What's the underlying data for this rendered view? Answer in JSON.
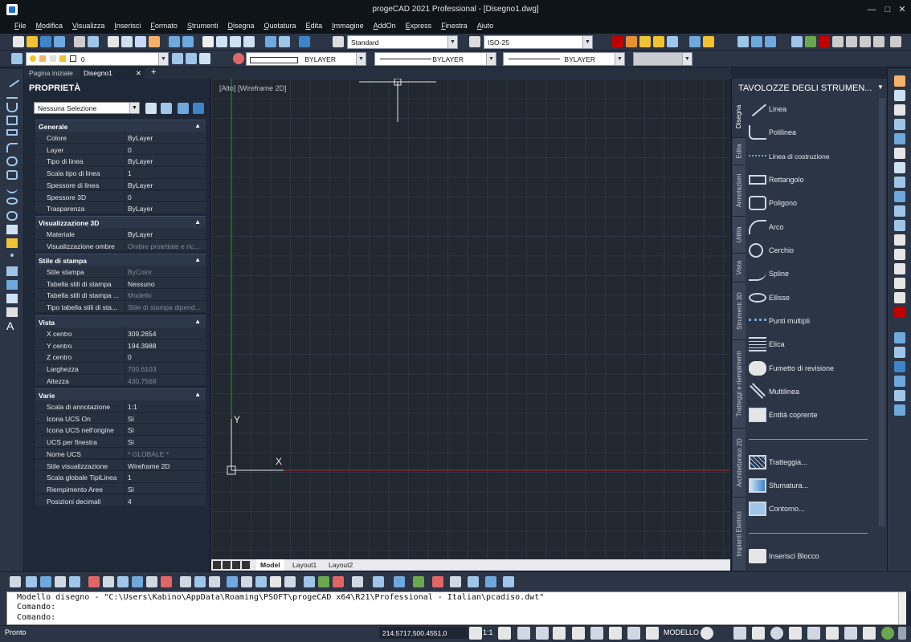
{
  "window": {
    "title": "progeCAD 2021 Professional - [Disegno1.dwg]",
    "minimize": "—",
    "restore": "□",
    "close": "✕"
  },
  "menu": [
    "File",
    "Modifica",
    "Visualizza",
    "Inserisci",
    "Formato",
    "Strumenti",
    "Disegna",
    "Quotatura",
    "Edita",
    "Immagine",
    "AddOn",
    "Express",
    "Finestra",
    "Aiuto"
  ],
  "toolbar": {
    "text_style": "Standard",
    "dim_style": "ISO-25",
    "layer": "0",
    "color": "BYLAYER",
    "linetype": "BYLAYER",
    "lineweight": "BYLAYER",
    "plot_style": ""
  },
  "tabs": {
    "home": "Pagina iniziale",
    "doc": "Disegno1",
    "close": "✕",
    "add": "+"
  },
  "properties": {
    "title": "PROPRIETÀ",
    "selection": "Nessuna Selezione",
    "sections": [
      {
        "name": "Generale",
        "rows": [
          {
            "k": "Colore",
            "v": "ByLayer"
          },
          {
            "k": "Layer",
            "v": "0"
          },
          {
            "k": "Tipo di linea",
            "v": "ByLayer"
          },
          {
            "k": "Scala tipo di linea",
            "v": "1"
          },
          {
            "k": "Spessore di linea",
            "v": "ByLayer"
          },
          {
            "k": "Spessore 3D",
            "v": "0"
          },
          {
            "k": "Trasparenza",
            "v": "ByLayer"
          }
        ]
      },
      {
        "name": "Visualizzazione 3D",
        "rows": [
          {
            "k": "Materiale",
            "v": "ByLayer"
          },
          {
            "k": "Visualizzazione ombre",
            "v": "Ombre proiettate e ric..."
          }
        ]
      },
      {
        "name": "Stile di stampa",
        "rows": [
          {
            "k": "Stile stampa",
            "v": "ByColor"
          },
          {
            "k": "Tabella stili di stampa",
            "v": "Nessuno"
          },
          {
            "k": "Tabella stili di stampa ...",
            "v": "Modello"
          },
          {
            "k": "Tipo tabella stili di sta...",
            "v": "Stile di stampa dipend..."
          }
        ]
      },
      {
        "name": "Vista",
        "rows": [
          {
            "k": "X centro",
            "v": "309.2654"
          },
          {
            "k": "Y centro",
            "v": "194.3988"
          },
          {
            "k": "Z centro",
            "v": "0"
          },
          {
            "k": "Larghezza",
            "v": "700.6103"
          },
          {
            "k": "Altezza",
            "v": "430.7568"
          }
        ]
      },
      {
        "name": "Varie",
        "rows": [
          {
            "k": "Scala di annotazione",
            "v": "1:1"
          },
          {
            "k": "Icona UCS On",
            "v": "Sì"
          },
          {
            "k": "Icona UCS nell'origine",
            "v": "Sì"
          },
          {
            "k": "UCS per finestra",
            "v": "Sì"
          },
          {
            "k": "Nome UCS",
            "v": "* GLOBALE *"
          },
          {
            "k": "Stile visualizzazione",
            "v": "Wireframe 2D"
          },
          {
            "k": "Scala globale TipiLinea",
            "v": "1"
          },
          {
            "k": "Riempimento Aree",
            "v": "Sì"
          },
          {
            "k": "Posizioni decimali",
            "v": "4"
          }
        ]
      }
    ]
  },
  "canvas": {
    "view_label": "[Alto] [Wireframe 2D]",
    "ucs_y": "Y",
    "ucs_x": "X"
  },
  "layout_tabs": [
    "Model",
    "Layout1",
    "Layout2"
  ],
  "palette": {
    "title": "TAVOLOZZE DEGLI STRUMEN...",
    "vtabs": [
      "Disegna",
      "Edita",
      "Annotazioni",
      "Utilità",
      "Vista",
      "Strumenti 3D",
      "Tratteggi e riempimenti",
      "Architettonico 2D",
      "Impianti Elettrici"
    ],
    "items": [
      "Linea",
      "Polilinea",
      "Linea di costruzione",
      "Rettangolo",
      "Poligono",
      "Arco",
      "Cerchio",
      "Spline",
      "Ellisse",
      "Punti multipli",
      "Elica",
      "Fumetto di revisione",
      "Multilinea",
      "Entità coprente"
    ],
    "items2": [
      "Tratteggia...",
      "Sfumatura...",
      "Contorno..."
    ],
    "items3": [
      "Inserisci Blocco"
    ]
  },
  "command": {
    "line1": "Modello disegno - \"C:\\Users\\Kabino\\AppData\\Roaming\\PSOFT\\progeCAD x64\\R21\\Professional - Italian\\pcadiso.dwt\"",
    "line2": "Comando:",
    "line3": "Comando:"
  },
  "status": {
    "ready": "Pronto",
    "coords": "214.5717,500.4551,0",
    "scale": "1:1",
    "model": "MODELLO"
  }
}
